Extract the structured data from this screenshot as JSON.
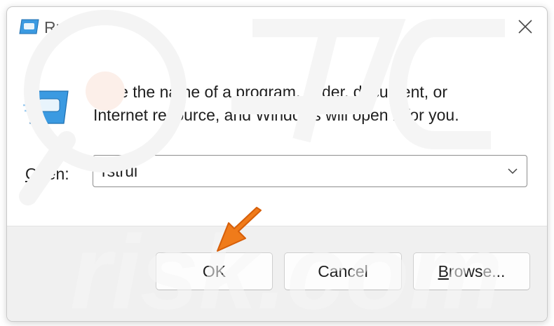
{
  "window": {
    "title": "Run"
  },
  "message": {
    "line1": "Type the name of a program, folder, document, or",
    "line2": "Internet resource, and Windows will open it for you."
  },
  "open_field": {
    "label_accel": "O",
    "label_rest": "pen:",
    "value": "rstrui"
  },
  "buttons": {
    "ok_label": "OK",
    "cancel_label": "Cancel",
    "browse_accel": "B",
    "browse_rest": "rowse..."
  },
  "icons": {
    "title": "run-app-icon",
    "large": "run-app-icon",
    "close": "close-icon",
    "dropdown": "chevron-down-icon",
    "annotation": "orange-arrow-pointer"
  },
  "colors": {
    "icon_blue": "#2f8fd8",
    "annotation_orange": "#f07b1a",
    "footer_bg": "#f0f0f0"
  },
  "watermark": {
    "text": "risk.com"
  }
}
